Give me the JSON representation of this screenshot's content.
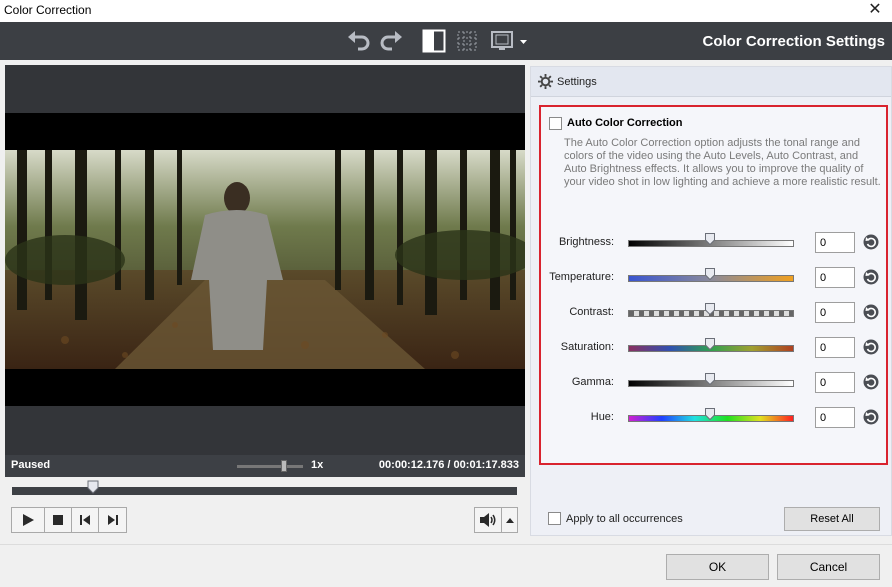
{
  "window": {
    "title": "Color Correction",
    "close_glyph": "✕"
  },
  "toolbar": {
    "title": "Color Correction Settings",
    "buttons": [
      "undo-icon",
      "redo-icon",
      "split-view-icon",
      "grid-view-icon",
      "monitor-icon"
    ]
  },
  "player": {
    "status": "Paused",
    "speed": "1x",
    "time_current": "00:00:12.176",
    "time_separator": " / ",
    "time_total": "00:01:17.833",
    "seek_fraction": 0.16
  },
  "settings": {
    "header": "Settings",
    "auto_correction": {
      "label": "Auto Color Correction",
      "checked": false,
      "description": "The Auto Color Correction option adjusts the tonal range and colors of the video using the Auto Levels, Auto Contrast, and Auto Brightness effects. It allows you to improve the quality of your video shot in low lighting and achieve a more realistic result."
    },
    "sliders": [
      {
        "label": "Brightness:",
        "value": "0"
      },
      {
        "label": "Temperature:",
        "value": "0"
      },
      {
        "label": "Contrast:",
        "value": "0"
      },
      {
        "label": "Saturation:",
        "value": "0"
      },
      {
        "label": "Gamma:",
        "value": "0"
      },
      {
        "label": "Hue:",
        "value": "0"
      }
    ],
    "apply_all": {
      "label": "Apply to all occurrences",
      "checked": false
    },
    "reset_all": "Reset All"
  },
  "footer": {
    "ok": "OK",
    "cancel": "Cancel"
  },
  "colors": {
    "toolbar_bg": "#3c3f44",
    "highlight_border": "#d9232e"
  }
}
